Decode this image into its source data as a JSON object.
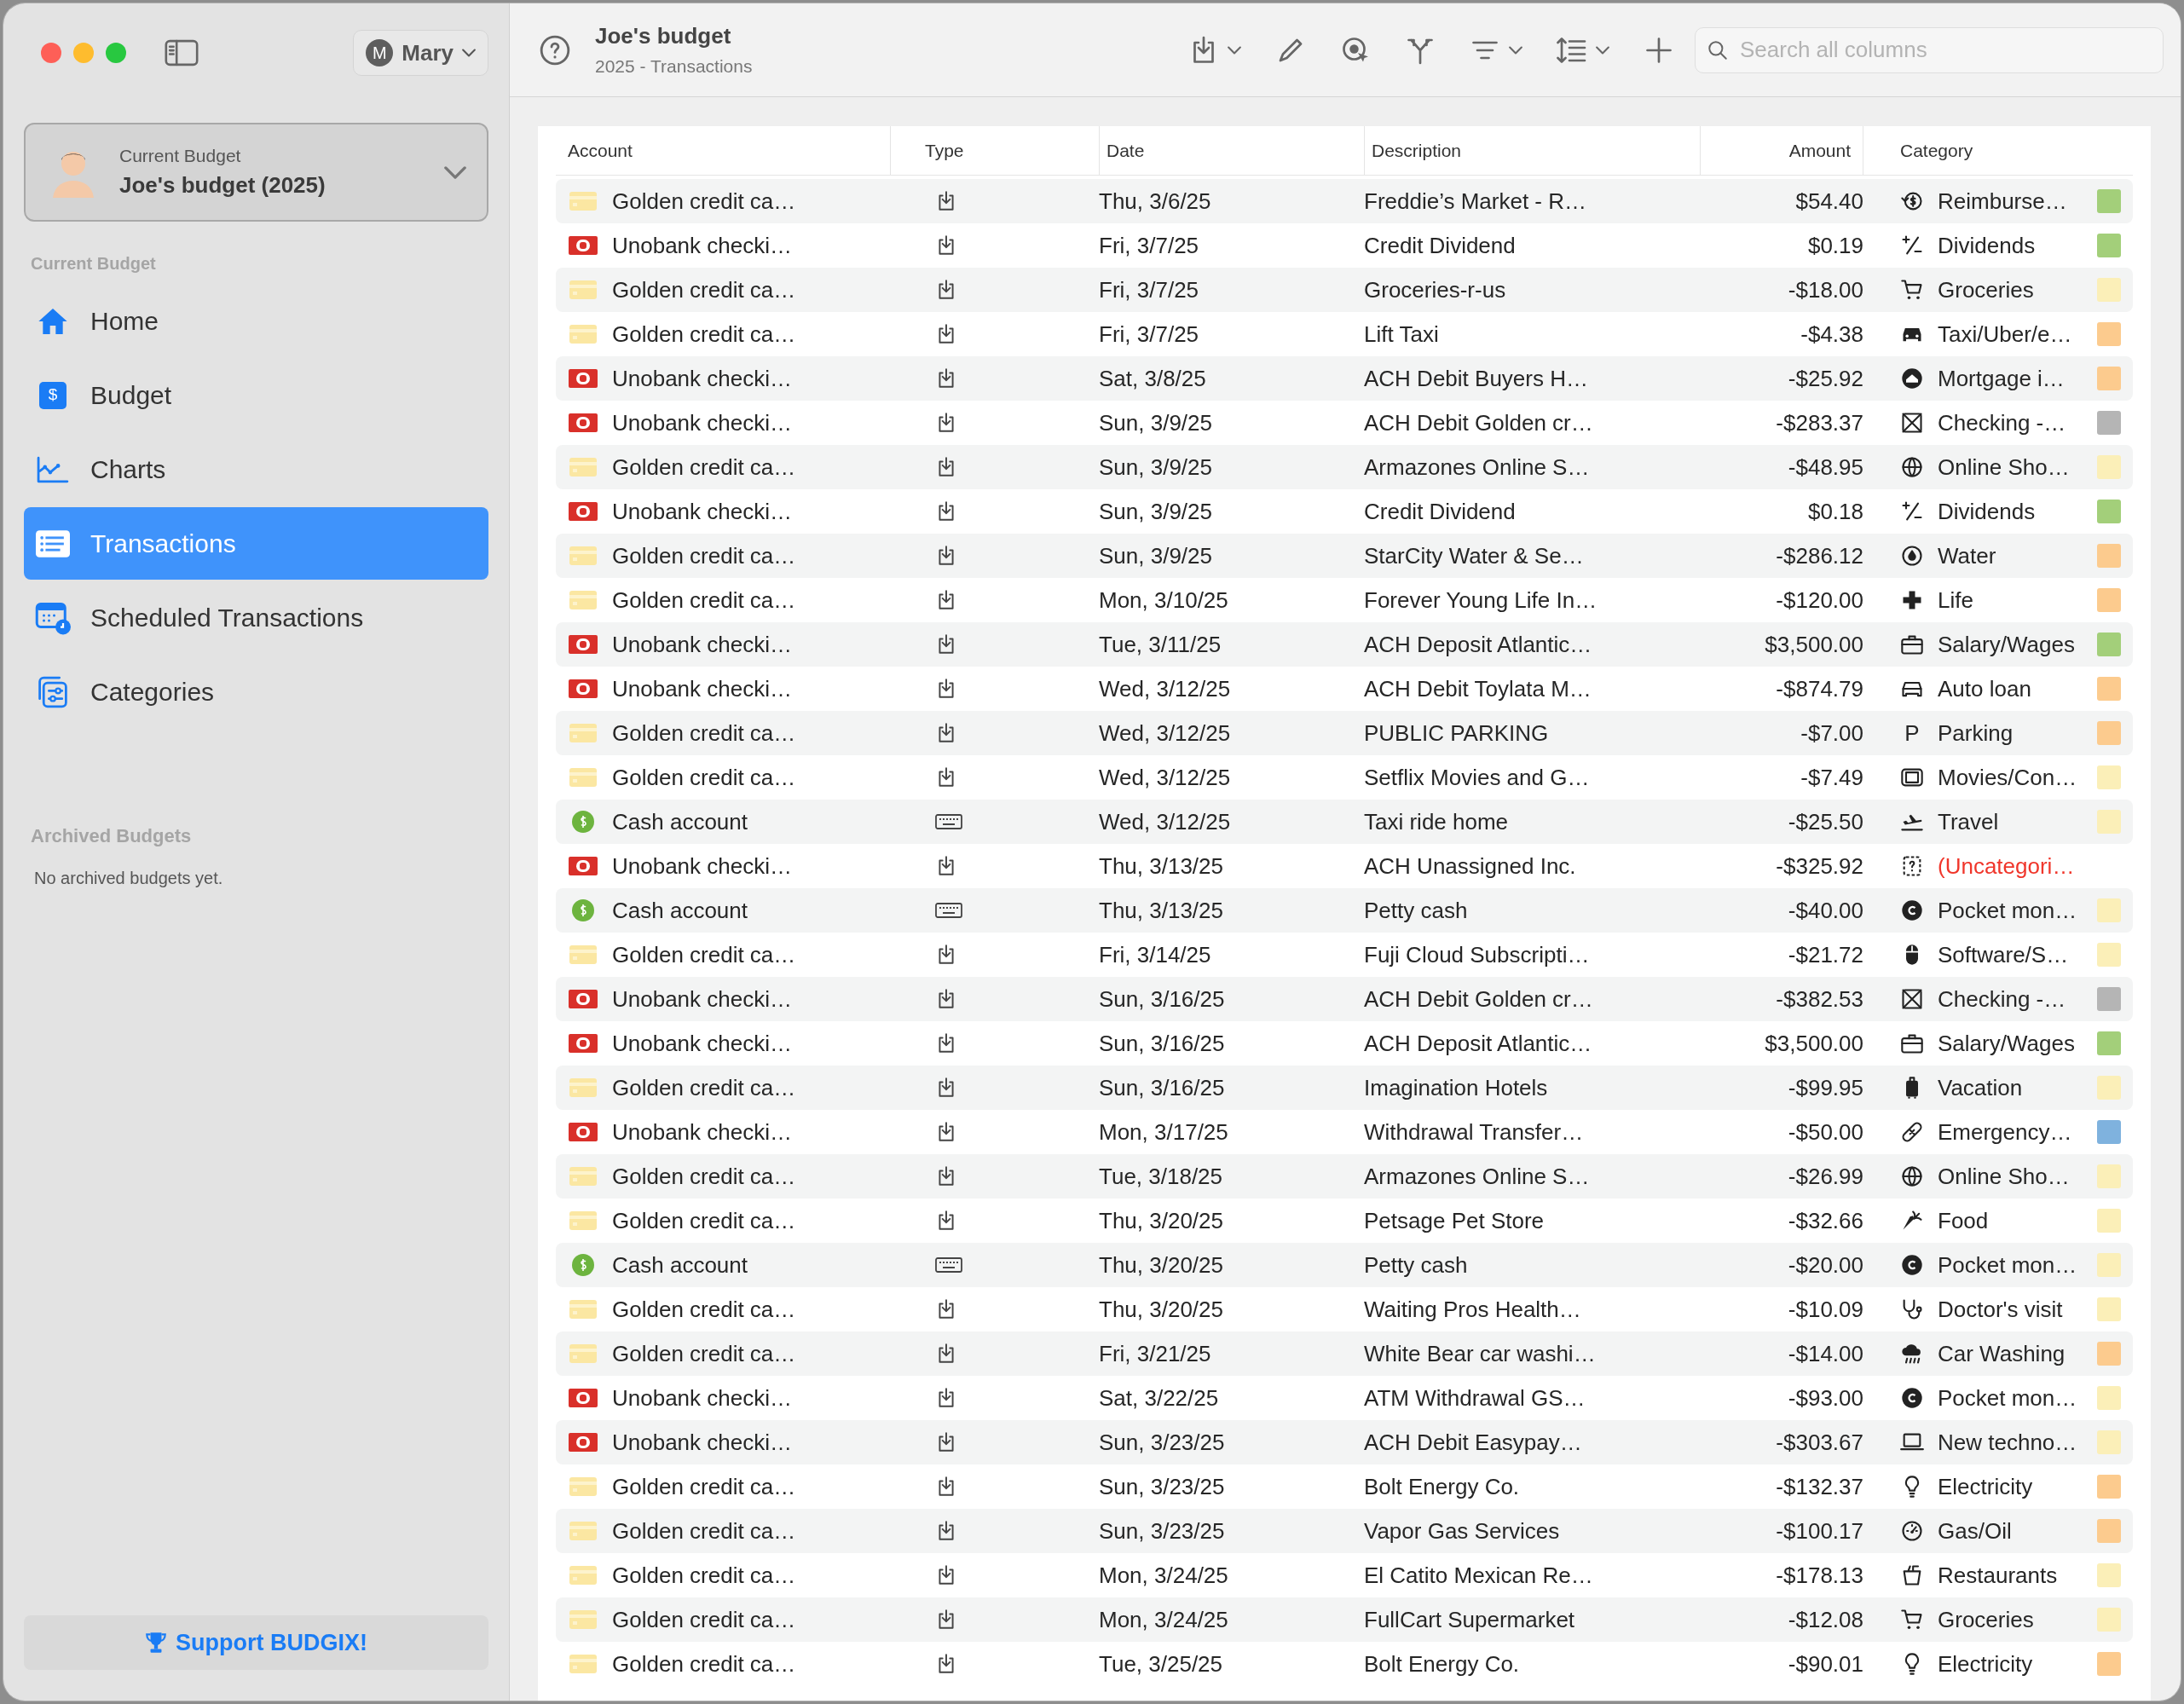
{
  "window": {
    "title": "Joe's budget",
    "subtitle": "2025 - Transactions"
  },
  "user": {
    "initial": "M",
    "name": "Mary"
  },
  "budget_picker": {
    "label": "Current Budget",
    "value": "Joe's budget (2025)"
  },
  "sidebar": {
    "section": "Current Budget",
    "items": [
      {
        "label": "Home",
        "kind": "home",
        "selected": false
      },
      {
        "label": "Budget",
        "kind": "budget",
        "glyph": "$",
        "selected": false
      },
      {
        "label": "Charts",
        "kind": "chart",
        "selected": false
      },
      {
        "label": "Transactions",
        "kind": "list",
        "selected": true
      },
      {
        "label": "Scheduled Transactions",
        "kind": "calendar",
        "selected": false
      },
      {
        "label": "Categories",
        "kind": "categories",
        "selected": false
      }
    ],
    "archived_title": "Archived Budgets",
    "archived_note": "No archived budgets yet.",
    "support_button": "Support BUDGIX!"
  },
  "search": {
    "placeholder": "Search all columns"
  },
  "table": {
    "columns": [
      "Account",
      "Type",
      "Date",
      "Description",
      "Amount",
      "Category"
    ],
    "rows": [
      {
        "account": {
          "name": "Golden credit ca…",
          "kind": "credit"
        },
        "type": {
          "kind": "download"
        },
        "date": "Thu, 3/6/25",
        "description": "Freddie’s Market - R…",
        "amount": "$54.40",
        "category": {
          "label": "Reimburse…",
          "kind": "reimburse",
          "uncategorized": false,
          "color": "#a3cf7a"
        }
      },
      {
        "account": {
          "name": "Unobank checki…",
          "kind": "bank"
        },
        "type": {
          "kind": "download"
        },
        "date": "Fri, 3/7/25",
        "description": "Credit Dividend",
        "amount": "$0.19",
        "category": {
          "label": "Dividends",
          "kind": "dividends",
          "uncategorized": false,
          "color": "#a3cf7a"
        }
      },
      {
        "account": {
          "name": "Golden credit ca…",
          "kind": "credit"
        },
        "type": {
          "kind": "download"
        },
        "date": "Fri, 3/7/25",
        "description": "Groceries-r-us",
        "amount": "-$18.00",
        "category": {
          "label": "Groceries",
          "kind": "cart",
          "uncategorized": false,
          "color": "#fbefb8"
        }
      },
      {
        "account": {
          "name": "Golden credit ca…",
          "kind": "credit"
        },
        "type": {
          "kind": "download"
        },
        "date": "Fri, 3/7/25",
        "description": "Lift Taxi",
        "amount": "-$4.38",
        "category": {
          "label": "Taxi/Uber/e…",
          "kind": "car",
          "uncategorized": false,
          "color": "#fccb8e"
        }
      },
      {
        "account": {
          "name": "Unobank checki…",
          "kind": "bank"
        },
        "type": {
          "kind": "download"
        },
        "date": "Sat, 3/8/25",
        "description": "ACH Debit Buyers H…",
        "amount": "-$25.92",
        "category": {
          "label": "Mortgage i…",
          "kind": "mortgage",
          "uncategorized": false,
          "color": "#fccb8e"
        }
      },
      {
        "account": {
          "name": "Unobank checki…",
          "kind": "bank"
        },
        "type": {
          "kind": "download"
        },
        "date": "Sun, 3/9/25",
        "description": "ACH Debit Golden cr…",
        "amount": "-$283.37",
        "category": {
          "label": "Checking -…",
          "kind": "xbox",
          "uncategorized": false,
          "color": "#b5b5b5"
        }
      },
      {
        "account": {
          "name": "Golden credit ca…",
          "kind": "credit"
        },
        "type": {
          "kind": "download"
        },
        "date": "Sun, 3/9/25",
        "description": "Armazones Online S…",
        "amount": "-$48.95",
        "category": {
          "label": "Online Sho…",
          "kind": "globe",
          "uncategorized": false,
          "color": "#fbefb8"
        }
      },
      {
        "account": {
          "name": "Unobank checki…",
          "kind": "bank"
        },
        "type": {
          "kind": "download"
        },
        "date": "Sun, 3/9/25",
        "description": "Credit Dividend",
        "amount": "$0.18",
        "category": {
          "label": "Dividends",
          "kind": "dividends",
          "uncategorized": false,
          "color": "#a3cf7a"
        }
      },
      {
        "account": {
          "name": "Golden credit ca…",
          "kind": "credit"
        },
        "type": {
          "kind": "download"
        },
        "date": "Sun, 3/9/25",
        "description": "StarCity Water & Se…",
        "amount": "-$286.12",
        "category": {
          "label": "Water",
          "kind": "drop",
          "uncategorized": false,
          "color": "#fccb8e"
        }
      },
      {
        "account": {
          "name": "Golden credit ca…",
          "kind": "credit"
        },
        "type": {
          "kind": "download"
        },
        "date": "Mon, 3/10/25",
        "description": "Forever Young Life In…",
        "amount": "-$120.00",
        "category": {
          "label": "Life",
          "kind": "cross",
          "uncategorized": false,
          "color": "#fccb8e"
        }
      },
      {
        "account": {
          "name": "Unobank checki…",
          "kind": "bank"
        },
        "type": {
          "kind": "download"
        },
        "date": "Tue, 3/11/25",
        "description": "ACH Deposit Atlantic…",
        "amount": "$3,500.00",
        "category": {
          "label": "Salary/Wages",
          "kind": "briefcase",
          "uncategorized": false,
          "color": "#a3cf7a"
        }
      },
      {
        "account": {
          "name": "Unobank checki…",
          "kind": "bank"
        },
        "type": {
          "kind": "download"
        },
        "date": "Wed, 3/12/25",
        "description": "ACH Debit Toylata M…",
        "amount": "-$874.79",
        "category": {
          "label": "Auto loan",
          "kind": "car-outline",
          "uncategorized": false,
          "color": "#fccb8e"
        }
      },
      {
        "account": {
          "name": "Golden credit ca…",
          "kind": "credit"
        },
        "type": {
          "kind": "download"
        },
        "date": "Wed, 3/12/25",
        "description": "PUBLIC PARKING",
        "amount": "-$7.00",
        "category": {
          "label": "Parking",
          "kind": "letter",
          "glyph": "P",
          "uncategorized": false,
          "color": "#fccb8e"
        }
      },
      {
        "account": {
          "name": "Golden credit ca…",
          "kind": "credit"
        },
        "type": {
          "kind": "download"
        },
        "date": "Wed, 3/12/25",
        "description": "Setflix Movies and G…",
        "amount": "-$7.49",
        "category": {
          "label": "Movies/Con…",
          "kind": "film",
          "uncategorized": false,
          "color": "#fbefb8"
        }
      },
      {
        "account": {
          "name": "Cash account",
          "kind": "cash"
        },
        "type": {
          "kind": "keyboard"
        },
        "date": "Wed, 3/12/25",
        "description": "Taxi ride home",
        "amount": "-$25.50",
        "category": {
          "label": "Travel",
          "kind": "plane",
          "uncategorized": false,
          "color": "#fbefb8"
        }
      },
      {
        "account": {
          "name": "Unobank checki…",
          "kind": "bank"
        },
        "type": {
          "kind": "download"
        },
        "date": "Thu, 3/13/25",
        "description": "ACH Unassigned Inc.",
        "amount": "-$325.92",
        "category": {
          "label": "(Uncategori…",
          "kind": "question",
          "uncategorized": true
        }
      },
      {
        "account": {
          "name": "Cash account",
          "kind": "cash"
        },
        "type": {
          "kind": "keyboard"
        },
        "date": "Thu, 3/13/25",
        "description": "Petty cash",
        "amount": "-$40.00",
        "category": {
          "label": "Pocket mon…",
          "kind": "coin",
          "uncategorized": false,
          "color": "#fbefb8"
        }
      },
      {
        "account": {
          "name": "Golden credit ca…",
          "kind": "credit"
        },
        "type": {
          "kind": "download"
        },
        "date": "Fri, 3/14/25",
        "description": "Fuji Cloud Subscripti…",
        "amount": "-$21.72",
        "category": {
          "label": "Software/S…",
          "kind": "mouse",
          "uncategorized": false,
          "color": "#fbefb8"
        }
      },
      {
        "account": {
          "name": "Unobank checki…",
          "kind": "bank"
        },
        "type": {
          "kind": "download"
        },
        "date": "Sun, 3/16/25",
        "description": "ACH Debit Golden cr…",
        "amount": "-$382.53",
        "category": {
          "label": "Checking -…",
          "kind": "xbox",
          "uncategorized": false,
          "color": "#b5b5b5"
        }
      },
      {
        "account": {
          "name": "Unobank checki…",
          "kind": "bank"
        },
        "type": {
          "kind": "download"
        },
        "date": "Sun, 3/16/25",
        "description": "ACH Deposit Atlantic…",
        "amount": "$3,500.00",
        "category": {
          "label": "Salary/Wages",
          "kind": "briefcase",
          "uncategorized": false,
          "color": "#a3cf7a"
        }
      },
      {
        "account": {
          "name": "Golden credit ca…",
          "kind": "credit"
        },
        "type": {
          "kind": "download"
        },
        "date": "Sun, 3/16/25",
        "description": "Imagination Hotels",
        "amount": "-$99.95",
        "category": {
          "label": "Vacation",
          "kind": "suitcase",
          "uncategorized": false,
          "color": "#fbefb8"
        }
      },
      {
        "account": {
          "name": "Unobank checki…",
          "kind": "bank"
        },
        "type": {
          "kind": "download"
        },
        "date": "Mon, 3/17/25",
        "description": "Withdrawal Transfer…",
        "amount": "-$50.00",
        "category": {
          "label": "Emergency…",
          "kind": "bandage",
          "uncategorized": false,
          "color": "#7fb2de"
        }
      },
      {
        "account": {
          "name": "Golden credit ca…",
          "kind": "credit"
        },
        "type": {
          "kind": "download"
        },
        "date": "Tue, 3/18/25",
        "description": "Armazones Online S…",
        "amount": "-$26.99",
        "category": {
          "label": "Online Sho…",
          "kind": "globe",
          "uncategorized": false,
          "color": "#fbefb8"
        }
      },
      {
        "account": {
          "name": "Golden credit ca…",
          "kind": "credit"
        },
        "type": {
          "kind": "download"
        },
        "date": "Thu, 3/20/25",
        "description": "Petsage Pet Store",
        "amount": "-$32.66",
        "category": {
          "label": "Food",
          "kind": "carrot",
          "uncategorized": false,
          "color": "#fbefb8"
        }
      },
      {
        "account": {
          "name": "Cash account",
          "kind": "cash"
        },
        "type": {
          "kind": "keyboard"
        },
        "date": "Thu, 3/20/25",
        "description": "Petty cash",
        "amount": "-$20.00",
        "category": {
          "label": "Pocket mon…",
          "kind": "coin",
          "uncategorized": false,
          "color": "#fbefb8"
        }
      },
      {
        "account": {
          "name": "Golden credit ca…",
          "kind": "credit"
        },
        "type": {
          "kind": "download"
        },
        "date": "Thu, 3/20/25",
        "description": "Waiting Pros Health…",
        "amount": "-$10.09",
        "category": {
          "label": "Doctor's visit",
          "kind": "stethoscope",
          "uncategorized": false,
          "color": "#fbefb8"
        }
      },
      {
        "account": {
          "name": "Golden credit ca…",
          "kind": "credit"
        },
        "type": {
          "kind": "download"
        },
        "date": "Fri, 3/21/25",
        "description": "White Bear car washi…",
        "amount": "-$14.00",
        "category": {
          "label": "Car Washing",
          "kind": "rain",
          "uncategorized": false,
          "color": "#fccb8e"
        }
      },
      {
        "account": {
          "name": "Unobank checki…",
          "kind": "bank"
        },
        "type": {
          "kind": "download"
        },
        "date": "Sat, 3/22/25",
        "description": "ATM Withdrawal GS…",
        "amount": "-$93.00",
        "category": {
          "label": "Pocket mon…",
          "kind": "coin",
          "uncategorized": false,
          "color": "#fbefb8"
        }
      },
      {
        "account": {
          "name": "Unobank checki…",
          "kind": "bank"
        },
        "type": {
          "kind": "download"
        },
        "date": "Sun, 3/23/25",
        "description": "ACH Debit Easypay…",
        "amount": "-$303.67",
        "category": {
          "label": "New techno…",
          "kind": "laptop",
          "uncategorized": false,
          "color": "#fbefb8"
        }
      },
      {
        "account": {
          "name": "Golden credit ca…",
          "kind": "credit"
        },
        "type": {
          "kind": "download"
        },
        "date": "Sun, 3/23/25",
        "description": "Bolt Energy Co.",
        "amount": "-$132.37",
        "category": {
          "label": "Electricity",
          "kind": "bulb",
          "uncategorized": false,
          "color": "#fccb8e"
        }
      },
      {
        "account": {
          "name": "Golden credit ca…",
          "kind": "credit"
        },
        "type": {
          "kind": "download"
        },
        "date": "Sun, 3/23/25",
        "description": "Vapor Gas Services",
        "amount": "-$100.17",
        "category": {
          "label": "Gas/Oil",
          "kind": "gauge",
          "uncategorized": false,
          "color": "#fccb8e"
        }
      },
      {
        "account": {
          "name": "Golden credit ca…",
          "kind": "credit"
        },
        "type": {
          "kind": "download"
        },
        "date": "Mon, 3/24/25",
        "description": "El Catito Mexican Re…",
        "amount": "-$178.13",
        "category": {
          "label": "Restaurants",
          "kind": "takeout",
          "uncategorized": false,
          "color": "#fbefb8"
        }
      },
      {
        "account": {
          "name": "Golden credit ca…",
          "kind": "credit"
        },
        "type": {
          "kind": "download"
        },
        "date": "Mon, 3/24/25",
        "description": "FullCart Supermarket",
        "amount": "-$12.08",
        "category": {
          "label": "Groceries",
          "kind": "cart",
          "uncategorized": false,
          "color": "#fbefb8"
        }
      },
      {
        "account": {
          "name": "Golden credit ca…",
          "kind": "credit"
        },
        "type": {
          "kind": "download"
        },
        "date": "Tue, 3/25/25",
        "description": "Bolt Energy Co.",
        "amount": "-$90.01",
        "category": {
          "label": "Electricity",
          "kind": "bulb",
          "uncategorized": false,
          "color": "#fccb8e"
        }
      }
    ]
  }
}
